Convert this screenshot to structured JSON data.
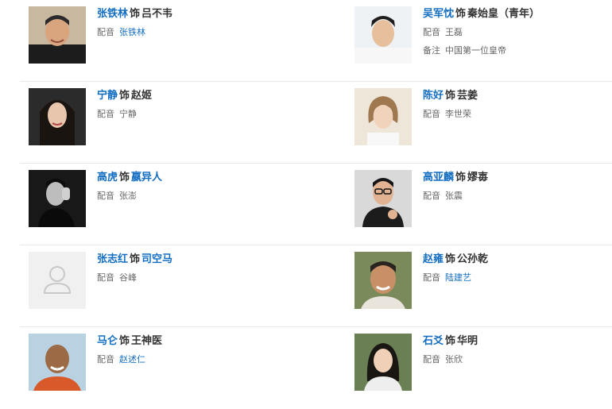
{
  "cast": [
    {
      "actor": "张铁林",
      "shi": "饰",
      "role": "吕不韦",
      "role_link": false,
      "dub_label": "配音",
      "dub": "张铁林",
      "dub_link": true,
      "note_label": "",
      "note": "",
      "photo": "portrait-male-smiling"
    },
    {
      "actor": "吴军忱",
      "shi": "饰",
      "role": "秦始皇（青年）",
      "role_link": false,
      "dub_label": "配音",
      "dub": "王磊",
      "dub_link": false,
      "note_label": "备注",
      "note": "中国第一位皇帝",
      "photo": "portrait-male-young"
    },
    {
      "actor": "宁静",
      "shi": "饰",
      "role": "赵姬",
      "role_link": false,
      "dub_label": "配音",
      "dub": "宁静",
      "dub_link": false,
      "note_label": "",
      "note": "",
      "photo": "portrait-female-long-hair"
    },
    {
      "actor": "陈好",
      "shi": "饰",
      "role": "芸姜",
      "role_link": false,
      "dub_label": "配音",
      "dub": "李世荣",
      "dub_link": false,
      "note_label": "",
      "note": "",
      "photo": "portrait-female-short-hair"
    },
    {
      "actor": "高虎",
      "shi": "饰",
      "role": "嬴异人",
      "role_link": true,
      "dub_label": "配音",
      "dub": "张澎",
      "dub_link": false,
      "note_label": "",
      "note": "",
      "photo": "portrait-male-black-white"
    },
    {
      "actor": "高亚麟",
      "shi": "饰",
      "role": "嫪毐",
      "role_link": false,
      "dub_label": "配音",
      "dub": "张震",
      "dub_link": false,
      "note_label": "",
      "note": "",
      "photo": "portrait-male-glasses"
    },
    {
      "actor": "张志红",
      "shi": "饰",
      "role": "司空马",
      "role_link": true,
      "dub_label": "配音",
      "dub": "谷峰",
      "dub_link": false,
      "note_label": "",
      "note": "",
      "photo": "placeholder-avatar"
    },
    {
      "actor": "赵雍",
      "shi": "饰",
      "role": "公孙乾",
      "role_link": false,
      "dub_label": "配音",
      "dub": "陆建艺",
      "dub_link": true,
      "note_label": "",
      "note": "",
      "photo": "portrait-male-older"
    },
    {
      "actor": "马仑",
      "shi": "饰",
      "role": "王神医",
      "role_link": false,
      "dub_label": "配音",
      "dub": "赵述仁",
      "dub_link": true,
      "note_label": "",
      "note": "",
      "photo": "portrait-male-bald"
    },
    {
      "actor": "石爻",
      "shi": "饰",
      "role": "华明",
      "role_link": false,
      "dub_label": "配音",
      "dub": "张欣",
      "dub_link": false,
      "note_label": "",
      "note": "",
      "photo": "portrait-female-outdoor"
    }
  ],
  "colors": {
    "link": "#136ec2",
    "text": "#333333",
    "meta": "#666666",
    "separator": "#e8e8e8"
  }
}
